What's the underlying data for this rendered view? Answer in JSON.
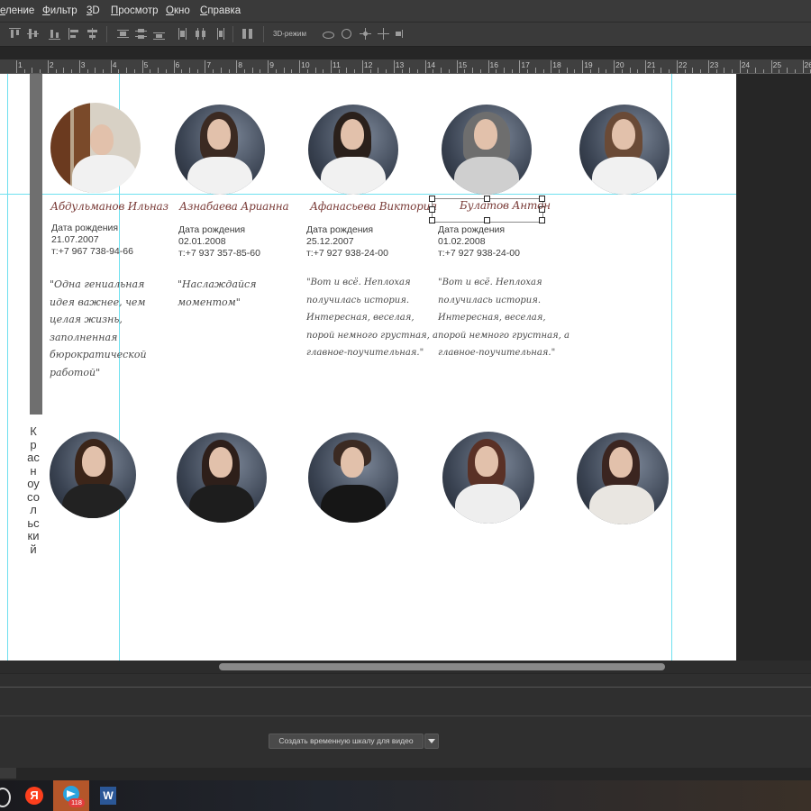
{
  "menu": [
    "еление",
    "Фильтр",
    "3D",
    "Просмотр",
    "Окно",
    "Справка"
  ],
  "options_bar": {
    "mode_3d_label": "3D-режим"
  },
  "ruler": {
    "numbers": [
      "1",
      "2",
      "3",
      "4",
      "5",
      "6",
      "7",
      "8",
      "9",
      "10",
      "11",
      "12",
      "13",
      "14",
      "15",
      "16",
      "17",
      "18",
      "19",
      "20",
      "21",
      "22",
      "23",
      "24",
      "25",
      "26"
    ]
  },
  "document": {
    "side_label": "Красноусольский",
    "students_row1": [
      {
        "name": "Абдульманов Ильназ",
        "dob_label": "Дата рождения",
        "dob": "21.07.2007",
        "phone": "т:+7 967 738-94-66",
        "quote": [
          "\"Одна гениальная",
          "идея важнее, чем",
          "целая жизнь,",
          "заполненная",
          "бюрократической",
          "работой\""
        ]
      },
      {
        "name": "Азнабаева Арианна",
        "dob_label": "Дата рождения",
        "dob": "02.01.2008",
        "phone": "т:+7 937 357-85-60",
        "quote": [
          "\"Наслаждайся",
          "моментом\""
        ]
      },
      {
        "name": "Афанасьева Виктория",
        "dob_label": "Дата рождения",
        "dob": "25.12.2007",
        "phone": "т:+7 927 938-24-00",
        "quote": [
          "\"Вот и всё. Неплохая",
          "получилась история.",
          "Интересная, веселая,",
          "порой немного грустная, а",
          "главное-поучительная.\""
        ]
      },
      {
        "name": "Булатов Антон",
        "dob_label": "Дата рождения",
        "dob": "01.02.2008",
        "phone": "т:+7 927 938-24-00",
        "quote": [
          "\"Вот и всё. Неплохая",
          "получилась история.",
          "Интересная, веселая,",
          "порой немного грустная, а",
          "главное-поучительная.\""
        ]
      },
      {
        "name": "",
        "dob_label": "",
        "dob": "",
        "phone": "",
        "quote": []
      }
    ]
  },
  "timeline": {
    "create_button": "Создать временную шкалу для видео"
  },
  "taskbar": {
    "yandex_glyph": "Я",
    "word_glyph": "W",
    "telegram_badge": "118"
  }
}
